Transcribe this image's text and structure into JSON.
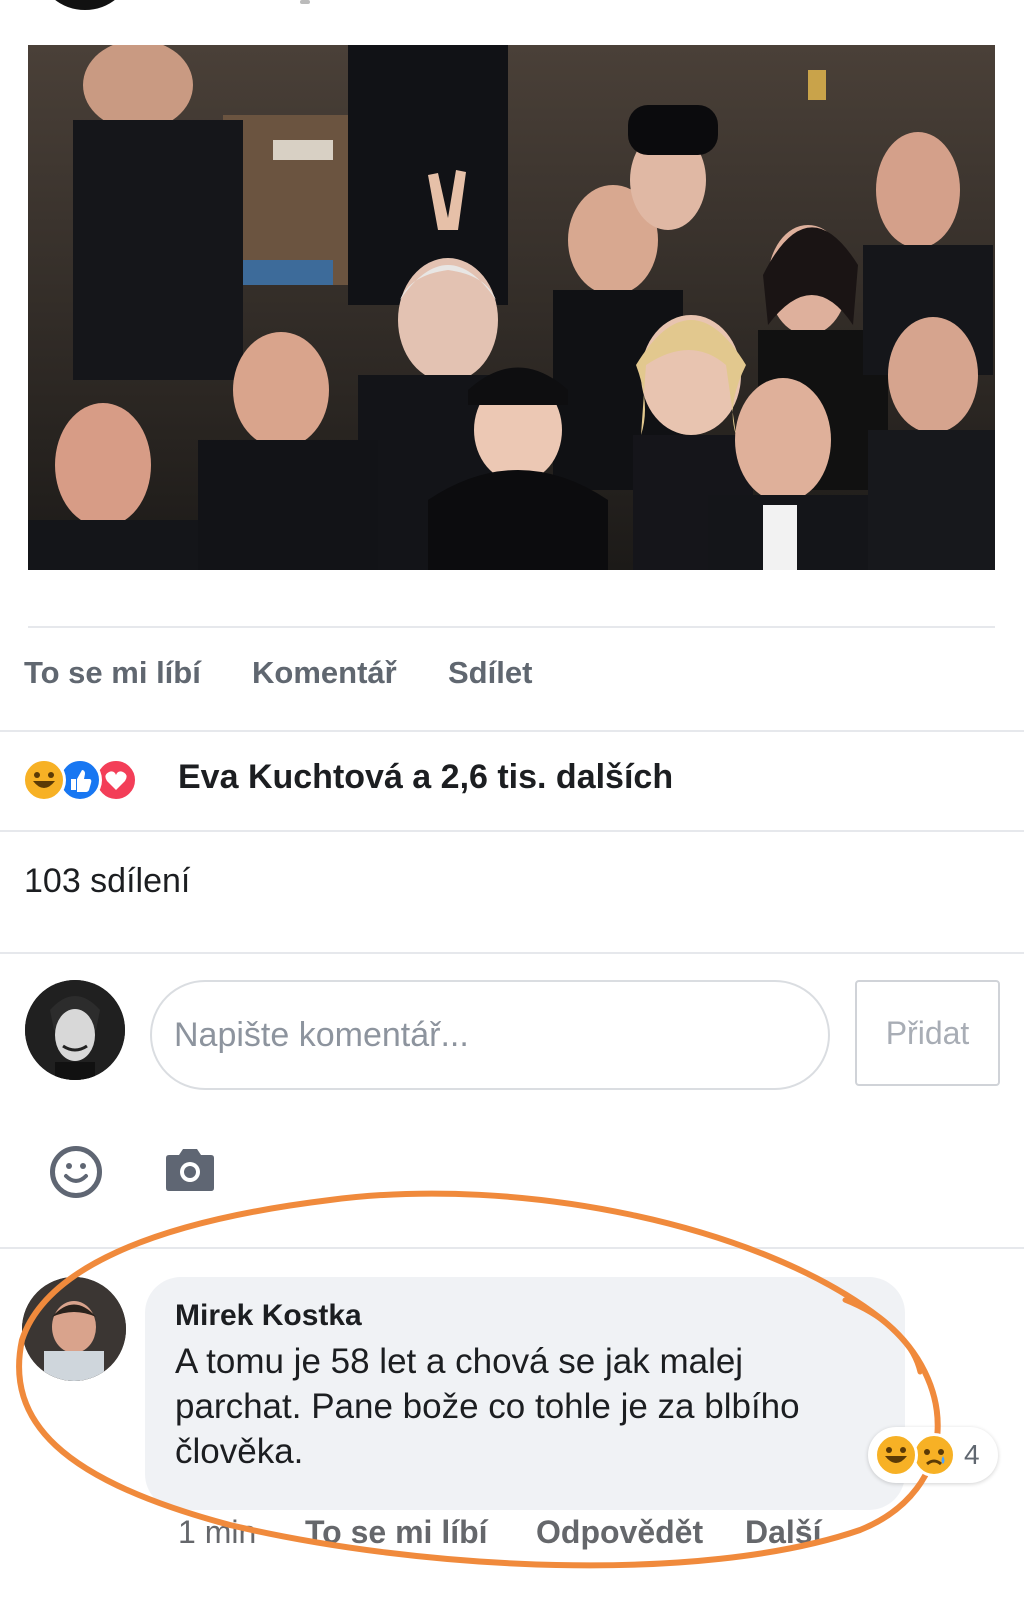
{
  "post": {
    "actions": {
      "like": "To se mi líbí",
      "comment": "Komentář",
      "share": "Sdílet"
    },
    "reactions": {
      "icons": [
        "haha-icon",
        "like-icon",
        "love-icon"
      ],
      "summary": "Eva Kuchtová a 2,6 tis. dalších"
    },
    "shares": "103 sdílení"
  },
  "composer": {
    "placeholder": "Napište komentář...",
    "add_label": "Přidat",
    "tools": [
      "emoji-icon",
      "camera-icon"
    ]
  },
  "comment": {
    "author": "Mirek Kostka",
    "text": "A tomu je 58 let a chová se jak malej parchat. Pane bože co tohle je za blbího člověka.",
    "reaction_count": "4",
    "time": "1 min",
    "like_label": "To se mi líbí",
    "reply_label": "Odpovědět",
    "more_label": "Další"
  },
  "colors": {
    "highlight_ring": "#f08a3c",
    "like_blue": "#1877f2",
    "love_red": "#f33e58",
    "haha_yellow": "#f7b125"
  }
}
